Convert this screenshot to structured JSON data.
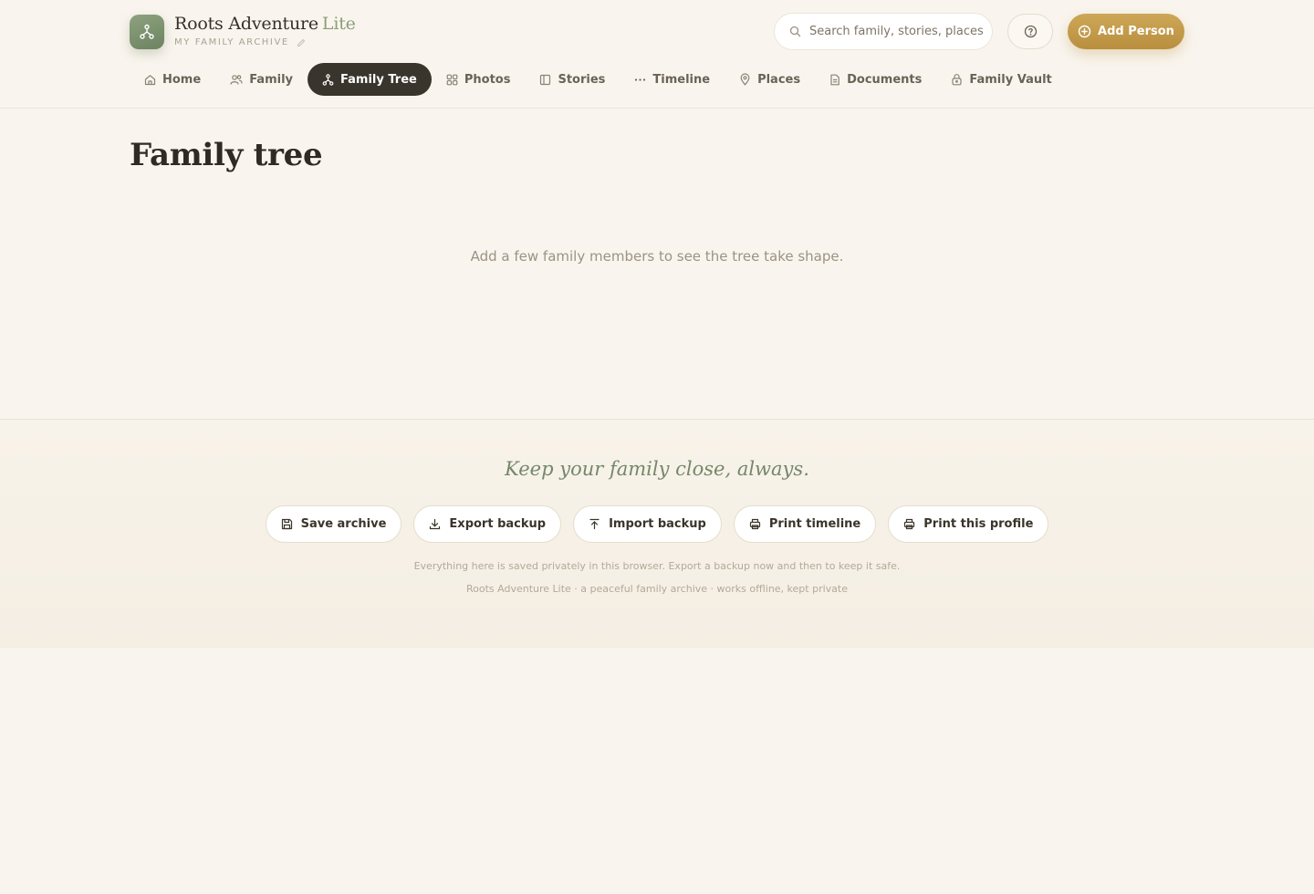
{
  "brand": {
    "name": "Roots Adventure",
    "name_suffix": "Lite",
    "subtitle": "MY FAMILY ARCHIVE"
  },
  "search": {
    "placeholder": "Search family, stories, places..."
  },
  "header": {
    "add_person_label": "Add Person"
  },
  "nav": {
    "items": [
      {
        "label": "Home",
        "icon": "home-icon"
      },
      {
        "label": "Family",
        "icon": "people-icon"
      },
      {
        "label": "Family Tree",
        "icon": "tree-icon",
        "active": true
      },
      {
        "label": "Photos",
        "icon": "grid-icon"
      },
      {
        "label": "Stories",
        "icon": "book-icon"
      },
      {
        "label": "Timeline",
        "icon": "dots-icon"
      },
      {
        "label": "Places",
        "icon": "pin-icon"
      },
      {
        "label": "Documents",
        "icon": "document-icon"
      },
      {
        "label": "Family Vault",
        "icon": "lock-icon"
      }
    ]
  },
  "main": {
    "title": "Family tree",
    "empty_message": "Add a few family members to see the tree take shape."
  },
  "footer": {
    "tagline": "Keep your family close, always.",
    "actions": [
      {
        "label": "Save archive",
        "icon": "save-icon"
      },
      {
        "label": "Export backup",
        "icon": "download-icon"
      },
      {
        "label": "Import backup",
        "icon": "upload-icon"
      },
      {
        "label": "Print timeline",
        "icon": "printer-icon"
      },
      {
        "label": "Print this profile",
        "icon": "printer-icon"
      }
    ],
    "note": "Everything here is saved privately in this browser. Export a backup now and then to keep it safe.",
    "credit": "Roots Adventure Lite · a peaceful family archive · works offline, kept private"
  },
  "colors": {
    "background": "#f9f5ee",
    "accent_gold": "#c49b4b",
    "accent_green": "#7a8f6c",
    "nav_active": "#3a352c"
  }
}
